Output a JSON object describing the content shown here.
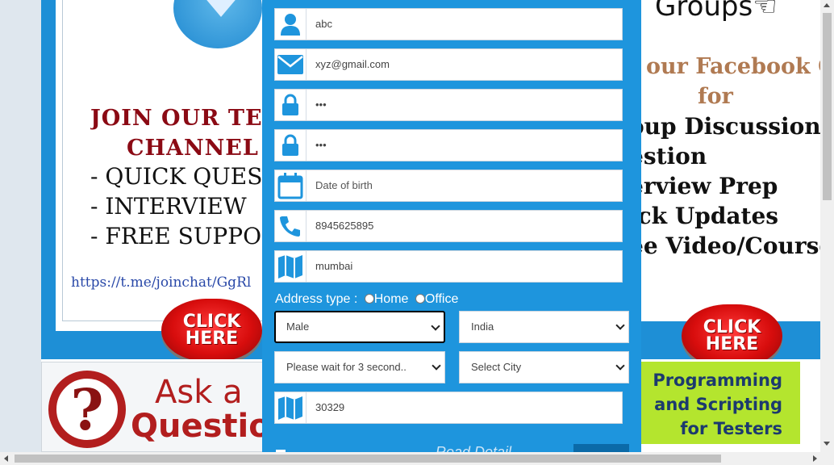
{
  "colors": {
    "form_bg": "#1e95dd",
    "icon": "#1e95dd",
    "accent_red": "#8b0a14",
    "brown": "#b07a52"
  },
  "left_ad": {
    "title_line1": "JOIN OUR TE",
    "title_line2": "CHANNEL",
    "bullets": [
      "- QUICK QUES",
      "- INTERVIEW",
      "- FREE SUPPO"
    ],
    "link": "https://t.me/joinchat/GgRl"
  },
  "right_ad": {
    "groups": "Groups",
    "title_line1": "n our Facebook G",
    "title_line2": "for",
    "list": [
      "oup Discussions",
      "estion",
      "erview Prep",
      "ick Updates",
      "ee Video/Course"
    ]
  },
  "click_button": {
    "line1": "CLICK",
    "line2": "HERE"
  },
  "ask_banner": {
    "line1": "Ask a",
    "line2": "Question"
  },
  "prog_banner": {
    "line1": "Programming",
    "line2": "and Scripting",
    "line3": "for Testers"
  },
  "form": {
    "name_value": "abc",
    "email_value": "xyz@gmail.com",
    "password_value": "•••",
    "confirm_password_value": "•••",
    "dob_placeholder": "Date of birth",
    "phone_value": "8945625895",
    "city_value": "mumbai",
    "address_type_label": "Address type :",
    "address_options": [
      "Home",
      "Office"
    ],
    "gender_selected": "Male",
    "country_selected": "India",
    "state_selected": "Please wait for 3 second..",
    "city_select": "Select City",
    "zip_value": "30329",
    "read_detail": "Read Detail"
  }
}
